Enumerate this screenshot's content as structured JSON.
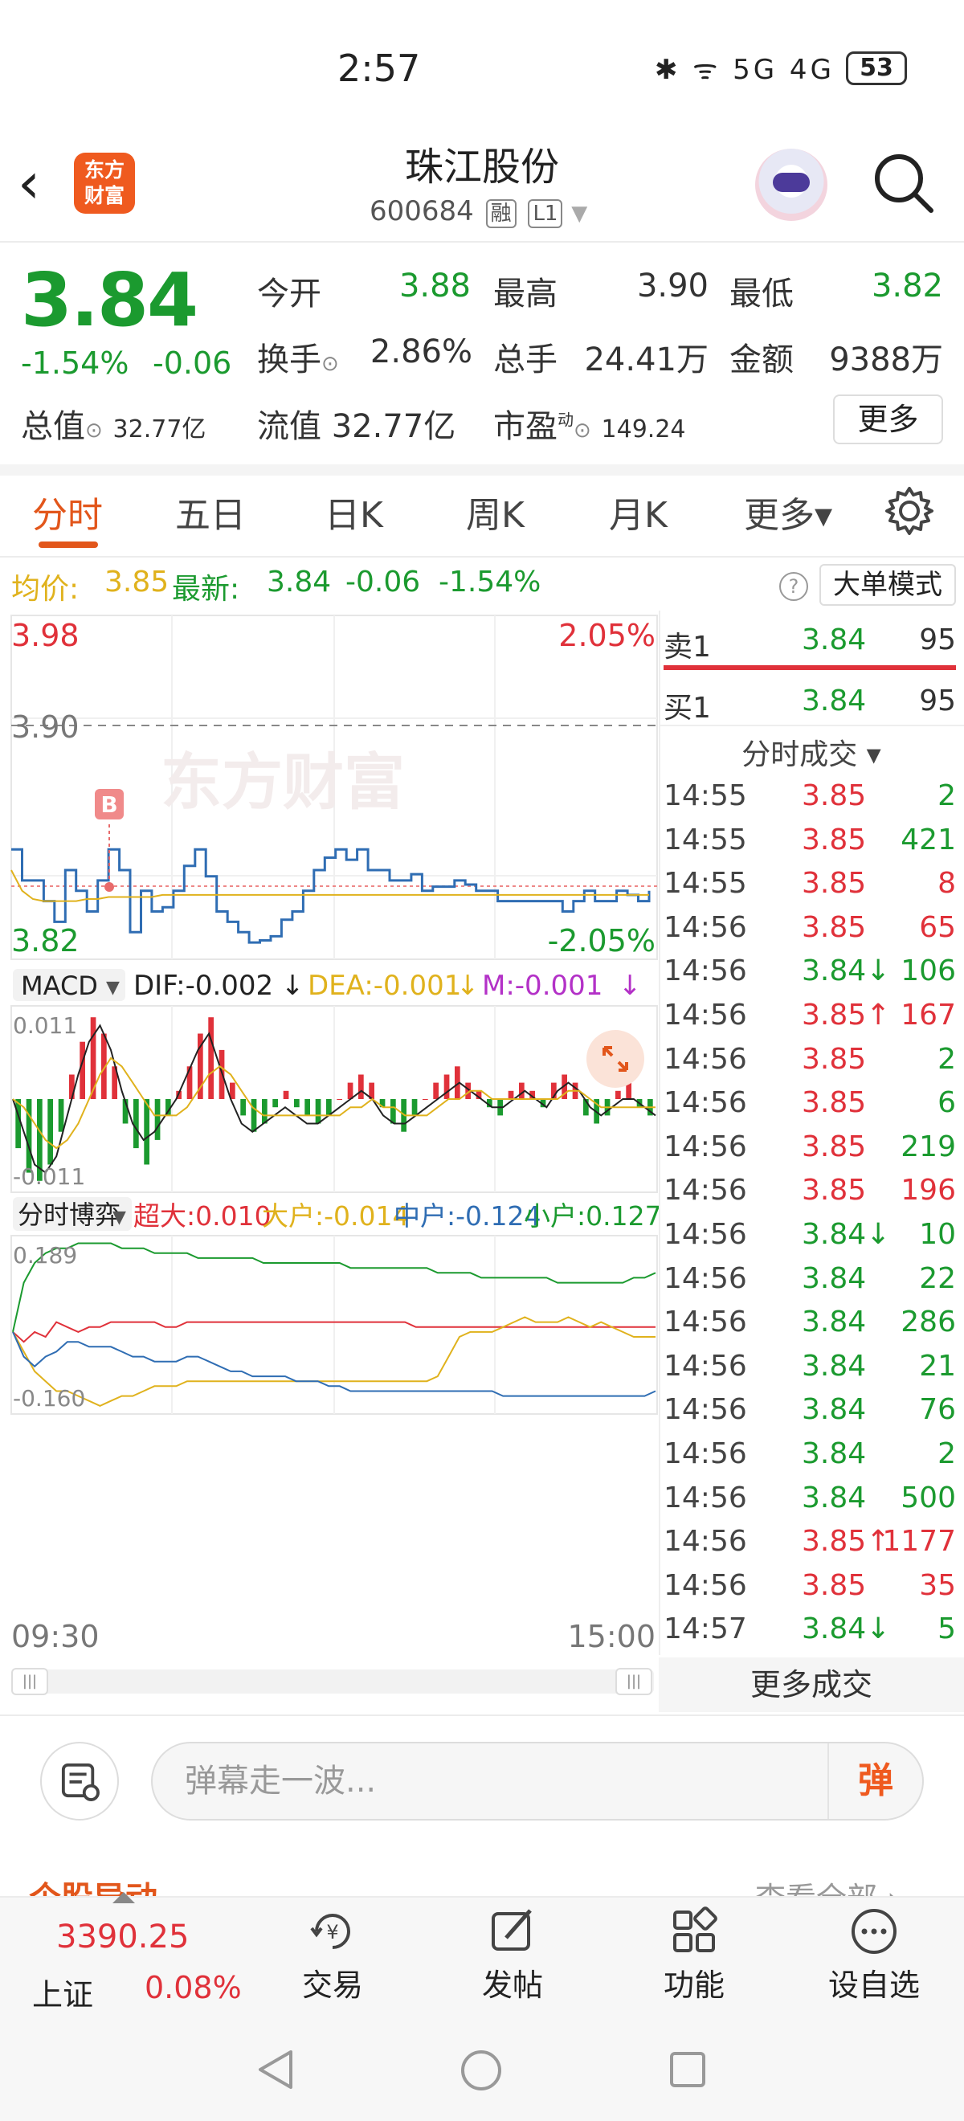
{
  "status_bar": {
    "time": "2:57",
    "icons": "✱ ᯤ 5G 4G",
    "battery": "53"
  },
  "header": {
    "logo_line1": "东方",
    "logo_line2": "财富",
    "stock_name": "珠江股份",
    "stock_code": "600684",
    "tag_margin": "融",
    "tag_level": "L1"
  },
  "quote": {
    "price": "3.84",
    "change_pct": "-1.54%",
    "change_abs": "-0.06",
    "open_label": "今开",
    "open": "3.88",
    "high_label": "最高",
    "high": "3.90",
    "low_label": "最低",
    "low": "3.82",
    "turnover_label": "换手",
    "turnover": "2.86%",
    "volume_label": "总手",
    "volume": "24.41万",
    "amount_label": "金额",
    "amount": "9388万",
    "mktcap_label": "总值",
    "mktcap": "32.77亿",
    "float_label": "流值",
    "float_cap": "32.77亿",
    "pe_label": "市盈",
    "pe_sup": "动",
    "pe": "149.24",
    "more_label": "更多"
  },
  "tabs": [
    {
      "label": "分时"
    },
    {
      "label": "五日"
    },
    {
      "label": "日K"
    },
    {
      "label": "周K"
    },
    {
      "label": "月K"
    },
    {
      "label": "更多▾"
    }
  ],
  "info_bar": {
    "avg_label": "均价:",
    "avg": "3.85",
    "latest_label": "最新:",
    "latest": "3.84",
    "latest_chg": "-0.06",
    "latest_pct": "-1.54%",
    "big_order_label": "大单模式",
    "help": "?"
  },
  "chart_data": [
    {
      "type": "line",
      "title": "",
      "ylim": [
        3.82,
        3.98
      ],
      "y_ticks_left": [
        "3.98",
        "3.90",
        "3.82"
      ],
      "y_ticks_right": [
        "2.05%",
        "-2.05%"
      ],
      "prev_close": "3.90",
      "watermark": "东方财富",
      "signal_marker": "B",
      "series": [
        {
          "name": "",
          "color": "#2f6db3",
          "values": [
            3.87,
            3.855,
            3.855,
            3.845,
            3.835,
            3.86,
            3.85,
            3.84,
            3.855,
            3.87,
            3.86,
            3.83,
            3.85,
            3.84,
            3.842,
            3.85,
            3.862,
            3.87,
            3.857,
            3.84,
            3.835,
            3.83,
            3.825,
            3.826,
            3.828,
            3.836,
            3.84,
            3.85,
            3.86,
            3.866,
            3.87,
            3.865,
            3.87,
            3.86,
            3.86,
            3.855,
            3.855,
            3.858,
            3.85,
            3.852,
            3.852,
            3.855,
            3.853,
            3.85,
            3.85,
            3.845,
            3.845,
            3.845,
            3.845,
            3.845,
            3.845,
            3.84,
            3.845,
            3.85,
            3.845,
            3.845,
            3.85,
            3.848,
            3.845,
            3.85
          ]
        },
        {
          "name": "",
          "color": "#e0b21d",
          "values": [
            3.86,
            3.85,
            3.846,
            3.845,
            3.845,
            3.845,
            3.845,
            3.846,
            3.846,
            3.847,
            3.847,
            3.847,
            3.847,
            3.847,
            3.848,
            3.848,
            3.848,
            3.848,
            3.848,
            3.848,
            3.848,
            3.848,
            3.848,
            3.848,
            3.848,
            3.848,
            3.848,
            3.848,
            3.848,
            3.848,
            3.848,
            3.848,
            3.848,
            3.848,
            3.848,
            3.848,
            3.848,
            3.848,
            3.848,
            3.848,
            3.848,
            3.848,
            3.848,
            3.848,
            3.848,
            3.848,
            3.848,
            3.848,
            3.848,
            3.848,
            3.848,
            3.848,
            3.848,
            3.848,
            3.848,
            3.848,
            3.848,
            3.848,
            3.848,
            3.848
          ]
        }
      ],
      "x_start": "09:30",
      "x_end": "15:00"
    },
    {
      "type": "bar",
      "title": "MACD",
      "legend": {
        "dif": "DIF:-0.002",
        "dea": "DEA:-0.001",
        "m": "M:-0.001"
      },
      "ylim": [
        -0.011,
        0.011
      ],
      "y_ticks": [
        "0.011",
        "-0.011"
      ],
      "series": [
        {
          "name": "M",
          "values": [
            -0.006,
            -0.009,
            -0.01,
            -0.008,
            -0.004,
            0.003,
            0.007,
            0.01,
            0.008,
            0.004,
            -0.003,
            -0.006,
            -0.008,
            -0.005,
            -0.002,
            0.001,
            0.004,
            0.008,
            0.01,
            0.006,
            0.002,
            -0.002,
            -0.004,
            -0.003,
            -0.001,
            0.001,
            -0.001,
            -0.002,
            -0.003,
            -0.002,
            0.0,
            0.002,
            0.003,
            0.002,
            -0.001,
            -0.003,
            -0.004,
            -0.002,
            0.0,
            0.002,
            0.003,
            0.004,
            0.002,
            0.001,
            -0.001,
            -0.002,
            0.001,
            0.002,
            0.001,
            -0.001,
            0.002,
            0.003,
            0.002,
            -0.002,
            -0.003,
            -0.002,
            0.001,
            0.002,
            -0.001,
            -0.002
          ]
        },
        {
          "name": "DIF",
          "values": [
            0.0,
            -0.004,
            -0.008,
            -0.009,
            -0.007,
            -0.002,
            0.003,
            0.007,
            0.009,
            0.006,
            0.001,
            -0.003,
            -0.005,
            -0.004,
            -0.002,
            0.0,
            0.003,
            0.006,
            0.008,
            0.004,
            0.0,
            -0.003,
            -0.004,
            -0.003,
            -0.002,
            -0.001,
            -0.002,
            -0.003,
            -0.003,
            -0.002,
            -0.001,
            0.0,
            0.001,
            0.0,
            -0.002,
            -0.003,
            -0.003,
            -0.002,
            -0.001,
            0.0,
            0.001,
            0.002,
            0.001,
            0.0,
            -0.001,
            -0.001,
            0.0,
            0.001,
            0.0,
            -0.001,
            0.001,
            0.002,
            0.001,
            -0.001,
            -0.002,
            -0.001,
            0.0,
            0.0,
            -0.001,
            -0.002
          ]
        },
        {
          "name": "DEA",
          "values": [
            0.0,
            -0.001,
            -0.003,
            -0.005,
            -0.006,
            -0.005,
            -0.003,
            0.0,
            0.003,
            0.005,
            0.004,
            0.002,
            0.0,
            -0.002,
            -0.002,
            -0.002,
            -0.001,
            0.001,
            0.003,
            0.004,
            0.003,
            0.001,
            -0.001,
            -0.002,
            -0.002,
            -0.002,
            -0.002,
            -0.002,
            -0.002,
            -0.002,
            -0.002,
            -0.001,
            -0.001,
            0.0,
            -0.001,
            -0.001,
            -0.002,
            -0.002,
            -0.002,
            -0.001,
            0.0,
            0.0,
            0.001,
            0.001,
            0.0,
            0.0,
            0.0,
            0.0,
            0.0,
            0.0,
            0.0,
            0.001,
            0.001,
            0.0,
            -0.001,
            -0.001,
            -0.001,
            -0.001,
            -0.001,
            -0.001
          ]
        }
      ]
    },
    {
      "type": "line",
      "title": "分时博弈",
      "legend": {
        "super": "超大:0.010",
        "large": "大户:-0.014",
        "mid": "中户:-0.124",
        "small": "小户:0.127"
      },
      "ylim": [
        -0.16,
        0.189
      ],
      "y_ticks": [
        "0.189",
        "-0.160"
      ],
      "series": [
        {
          "name": "超大",
          "color": "#e0313a",
          "values": [
            0.0,
            -0.02,
            0.0,
            -0.01,
            0.02,
            0.01,
            0.0,
            0.01,
            0.01,
            0.02,
            0.02,
            0.02,
            0.02,
            0.02,
            0.01,
            0.01,
            0.02,
            0.02,
            0.02,
            0.02,
            0.02,
            0.02,
            0.02,
            0.02,
            0.02,
            0.02,
            0.02,
            0.02,
            0.02,
            0.02,
            0.02,
            0.02,
            0.02,
            0.02,
            0.02,
            0.02,
            0.02,
            0.01,
            0.01,
            0.01,
            0.01,
            0.01,
            0.01,
            0.01,
            0.01,
            0.01,
            0.01,
            0.01,
            0.01,
            0.01,
            0.01,
            0.01,
            0.01,
            0.01,
            0.01,
            0.01,
            0.01,
            0.01,
            0.01,
            0.01
          ]
        },
        {
          "name": "大户",
          "color": "#e0b21d",
          "values": [
            0.0,
            -0.04,
            -0.08,
            -0.1,
            -0.12,
            -0.12,
            -0.13,
            -0.14,
            -0.15,
            -0.14,
            -0.13,
            -0.13,
            -0.12,
            -0.11,
            -0.11,
            -0.11,
            -0.1,
            -0.1,
            -0.1,
            -0.1,
            -0.1,
            -0.1,
            -0.1,
            -0.1,
            -0.1,
            -0.1,
            -0.1,
            -0.1,
            -0.1,
            -0.1,
            -0.1,
            -0.1,
            -0.1,
            -0.1,
            -0.1,
            -0.1,
            -0.1,
            -0.1,
            -0.1,
            -0.09,
            -0.05,
            -0.01,
            0.0,
            0.0,
            0.0,
            0.01,
            0.02,
            0.03,
            0.02,
            0.02,
            0.02,
            0.03,
            0.02,
            0.01,
            0.02,
            0.01,
            0.0,
            -0.01,
            -0.01,
            -0.01
          ]
        },
        {
          "name": "中户",
          "color": "#2f6db3",
          "values": [
            0.0,
            -0.05,
            -0.07,
            -0.05,
            -0.04,
            -0.02,
            -0.02,
            -0.03,
            -0.03,
            -0.03,
            -0.04,
            -0.05,
            -0.05,
            -0.06,
            -0.06,
            -0.06,
            -0.05,
            -0.05,
            -0.06,
            -0.07,
            -0.08,
            -0.08,
            -0.09,
            -0.09,
            -0.09,
            -0.09,
            -0.1,
            -0.1,
            -0.1,
            -0.11,
            -0.11,
            -0.12,
            -0.12,
            -0.12,
            -0.12,
            -0.12,
            -0.12,
            -0.12,
            -0.12,
            -0.12,
            -0.12,
            -0.12,
            -0.12,
            -0.12,
            -0.12,
            -0.13,
            -0.13,
            -0.13,
            -0.13,
            -0.13,
            -0.13,
            -0.13,
            -0.13,
            -0.13,
            -0.13,
            -0.13,
            -0.13,
            -0.13,
            -0.13,
            -0.12
          ]
        },
        {
          "name": "小户",
          "color": "#1b9a2f",
          "values": [
            0.0,
            0.1,
            0.14,
            0.16,
            0.17,
            0.17,
            0.18,
            0.18,
            0.18,
            0.18,
            0.17,
            0.17,
            0.17,
            0.16,
            0.16,
            0.16,
            0.16,
            0.15,
            0.15,
            0.15,
            0.15,
            0.15,
            0.15,
            0.14,
            0.14,
            0.14,
            0.14,
            0.14,
            0.14,
            0.14,
            0.14,
            0.13,
            0.13,
            0.13,
            0.13,
            0.13,
            0.13,
            0.13,
            0.13,
            0.12,
            0.12,
            0.12,
            0.12,
            0.11,
            0.11,
            0.11,
            0.11,
            0.11,
            0.11,
            0.11,
            0.1,
            0.1,
            0.1,
            0.1,
            0.1,
            0.1,
            0.1,
            0.11,
            0.11,
            0.12
          ]
        }
      ]
    }
  ],
  "order_book": {
    "sell1_label": "卖1",
    "sell1_price": "3.84",
    "sell1_vol": "95",
    "buy1_label": "买1",
    "buy1_price": "3.84",
    "buy1_vol": "95"
  },
  "trades_title": "分时成交 ▾",
  "trades": [
    {
      "time": "14:55",
      "price": "3.85",
      "vol": "2",
      "dir": "",
      "vol_color": "green"
    },
    {
      "time": "14:55",
      "price": "3.85",
      "vol": "421",
      "dir": "",
      "vol_color": "green"
    },
    {
      "time": "14:55",
      "price": "3.85",
      "vol": "8",
      "dir": "",
      "vol_color": "red"
    },
    {
      "time": "14:56",
      "price": "3.85",
      "vol": "65",
      "dir": "",
      "vol_color": "red"
    },
    {
      "time": "14:56",
      "price": "3.84",
      "vol": "106",
      "dir": "↓",
      "vol_color": "green"
    },
    {
      "time": "14:56",
      "price": "3.85",
      "vol": "167",
      "dir": "↑",
      "vol_color": "red"
    },
    {
      "time": "14:56",
      "price": "3.85",
      "vol": "2",
      "dir": "",
      "vol_color": "green"
    },
    {
      "time": "14:56",
      "price": "3.85",
      "vol": "6",
      "dir": "",
      "vol_color": "green"
    },
    {
      "time": "14:56",
      "price": "3.85",
      "vol": "219",
      "dir": "",
      "vol_color": "green"
    },
    {
      "time": "14:56",
      "price": "3.85",
      "vol": "196",
      "dir": "",
      "vol_color": "red"
    },
    {
      "time": "14:56",
      "price": "3.84",
      "vol": "10",
      "dir": "↓",
      "vol_color": "green"
    },
    {
      "time": "14:56",
      "price": "3.84",
      "vol": "22",
      "dir": "",
      "vol_color": "green"
    },
    {
      "time": "14:56",
      "price": "3.84",
      "vol": "286",
      "dir": "",
      "vol_color": "green"
    },
    {
      "time": "14:56",
      "price": "3.84",
      "vol": "21",
      "dir": "",
      "vol_color": "green"
    },
    {
      "time": "14:56",
      "price": "3.84",
      "vol": "76",
      "dir": "",
      "vol_color": "green"
    },
    {
      "time": "14:56",
      "price": "3.84",
      "vol": "2",
      "dir": "",
      "vol_color": "green"
    },
    {
      "time": "14:56",
      "price": "3.84",
      "vol": "500",
      "dir": "",
      "vol_color": "green"
    },
    {
      "time": "14:56",
      "price": "3.85",
      "vol": "1177",
      "dir": "↑",
      "vol_color": "red"
    },
    {
      "time": "14:56",
      "price": "3.85",
      "vol": "35",
      "dir": "",
      "vol_color": "red"
    },
    {
      "time": "14:57",
      "price": "3.84",
      "vol": "5",
      "dir": "↓",
      "vol_color": "green"
    }
  ],
  "more_trades_label": "更多成交",
  "comment": {
    "placeholder": "弹幕走一波...",
    "send_label": "弹"
  },
  "section_peek": {
    "title": "个股异动",
    "link": "查看全部 ›"
  },
  "bottom_nav": {
    "index_value": "3390.25",
    "index_name": "上证",
    "index_pct": "0.08%",
    "items": [
      {
        "label": "交易"
      },
      {
        "label": "发帖"
      },
      {
        "label": "功能"
      },
      {
        "label": "设自选"
      }
    ]
  },
  "colors": {
    "up": "#e0313a",
    "down": "#1b9a2f",
    "accent": "#e2561b",
    "avg_line": "#e0b21d",
    "price_line": "#2f6db3"
  }
}
